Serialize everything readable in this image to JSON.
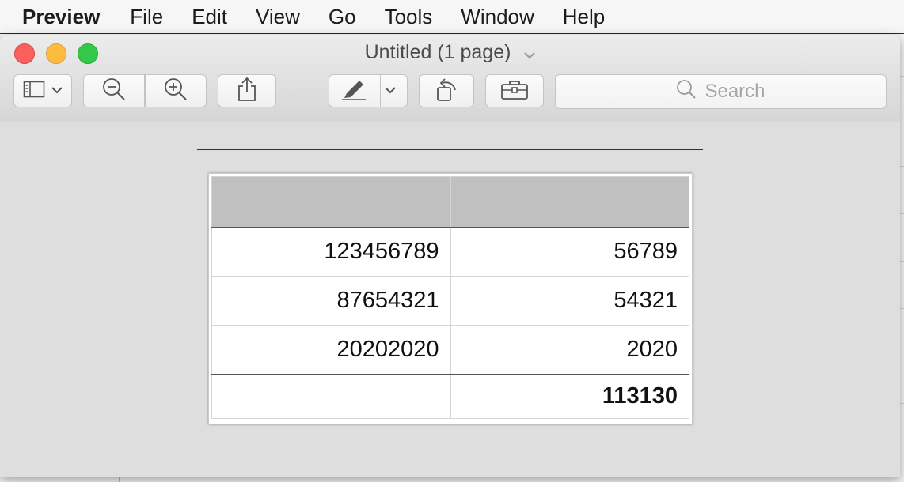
{
  "menubar": {
    "app": "Preview",
    "items": [
      "File",
      "Edit",
      "View",
      "Go",
      "Tools",
      "Window",
      "Help"
    ]
  },
  "window": {
    "title": "Untitled (1 page)"
  },
  "toolbar": {
    "search_placeholder": "Search",
    "icons": [
      "sidebar-icon",
      "zoom-out-icon",
      "zoom-in-icon",
      "share-icon",
      "markup-icon",
      "rotate-icon",
      "toolbox-icon",
      "search-icon"
    ]
  },
  "table": {
    "header": [
      "",
      ""
    ],
    "rows": [
      [
        "123456789",
        "56789"
      ],
      [
        "87654321",
        "54321"
      ],
      [
        "20202020",
        "2020"
      ]
    ],
    "footer": [
      "",
      "113130"
    ]
  },
  "colors": {
    "close": "#fc605c",
    "minimize": "#fdbc40",
    "maximize": "#34c84a",
    "header_fill": "#bfc0bf"
  }
}
